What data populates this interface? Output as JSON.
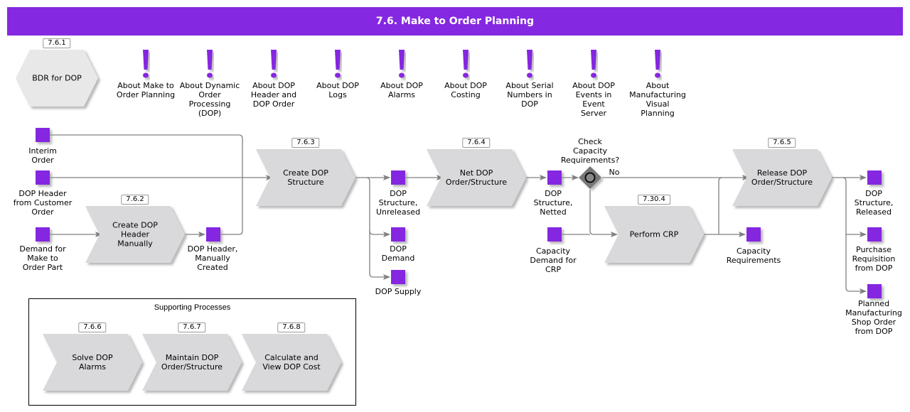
{
  "header": {
    "title": "7.6. Make to Order Planning"
  },
  "colors": {
    "accent": "#8528e1",
    "process_fill": "#d9d9db",
    "hexagon_fill": "#e8e8e8",
    "connector": "#808080"
  },
  "bdr": {
    "number": "7.6.1",
    "label": "BDR for DOP"
  },
  "about_items": [
    {
      "icon": "exclamation-icon",
      "label": "About Make to\nOrder Planning"
    },
    {
      "icon": "exclamation-icon",
      "label": "About Dynamic\nOrder\nProcessing\n(DOP)"
    },
    {
      "icon": "exclamation-icon",
      "label": "About DOP\nHeader and\nDOP Order"
    },
    {
      "icon": "exclamation-icon",
      "label": "About DOP\nLogs"
    },
    {
      "icon": "exclamation-icon",
      "label": "About DOP\nAlarms"
    },
    {
      "icon": "exclamation-icon",
      "label": "About DOP\nCosting"
    },
    {
      "icon": "exclamation-icon",
      "label": "About Serial\nNumbers in\nDOP"
    },
    {
      "icon": "exclamation-icon",
      "label": "About DOP\nEvents in\nEvent\nServer"
    },
    {
      "icon": "exclamation-icon",
      "label": "About\nManufacturing\nVisual\nPlanning"
    }
  ],
  "processes": {
    "create_header": {
      "number": "7.6.2",
      "label": "Create DOP\nHeader\nManually"
    },
    "create_structure": {
      "number": "7.6.3",
      "label": "Create DOP\nStructure"
    },
    "net_order": {
      "number": "7.6.4",
      "label": "Net DOP\nOrder/Structure"
    },
    "perform_crp": {
      "number": "7.30.4",
      "label": "Perform CRP"
    },
    "release_order": {
      "number": "7.6.5",
      "label": "Release DOP\nOrder/Structure"
    }
  },
  "data_objects": {
    "interim_order": "Interim\nOrder",
    "dop_header_customer": "DOP Header\nfrom Customer\nOrder",
    "demand_mto": "Demand for\nMake to\nOrder Part",
    "dop_header_manual": "DOP Header,\nManually\nCreated",
    "structure_unreleased": "DOP\nStructure,\nUnreleased",
    "dop_demand": "DOP\nDemand",
    "dop_supply": "DOP Supply",
    "structure_netted": "DOP\nStructure,\nNetted",
    "capacity_demand": "Capacity\nDemand for\nCRP",
    "capacity_requirements": "Capacity\nRequirements",
    "structure_released": "DOP\nStructure,\nReleased",
    "purchase_requisition": "Purchase\nRequisition\nfrom DOP",
    "planned_shop_order": "Planned\nManufacturing\nShop Order\nfrom DOP"
  },
  "gateway": {
    "label": "Check\nCapacity\nRequirements?",
    "no_label": "No"
  },
  "supporting": {
    "title": "Supporting Processes",
    "items": [
      {
        "number": "7.6.6",
        "label": "Solve DOP\nAlarms"
      },
      {
        "number": "7.6.7",
        "label": "Maintain DOP\nOrder/Structure"
      },
      {
        "number": "7.6.8",
        "label": "Calculate and\nView DOP Cost"
      }
    ]
  }
}
